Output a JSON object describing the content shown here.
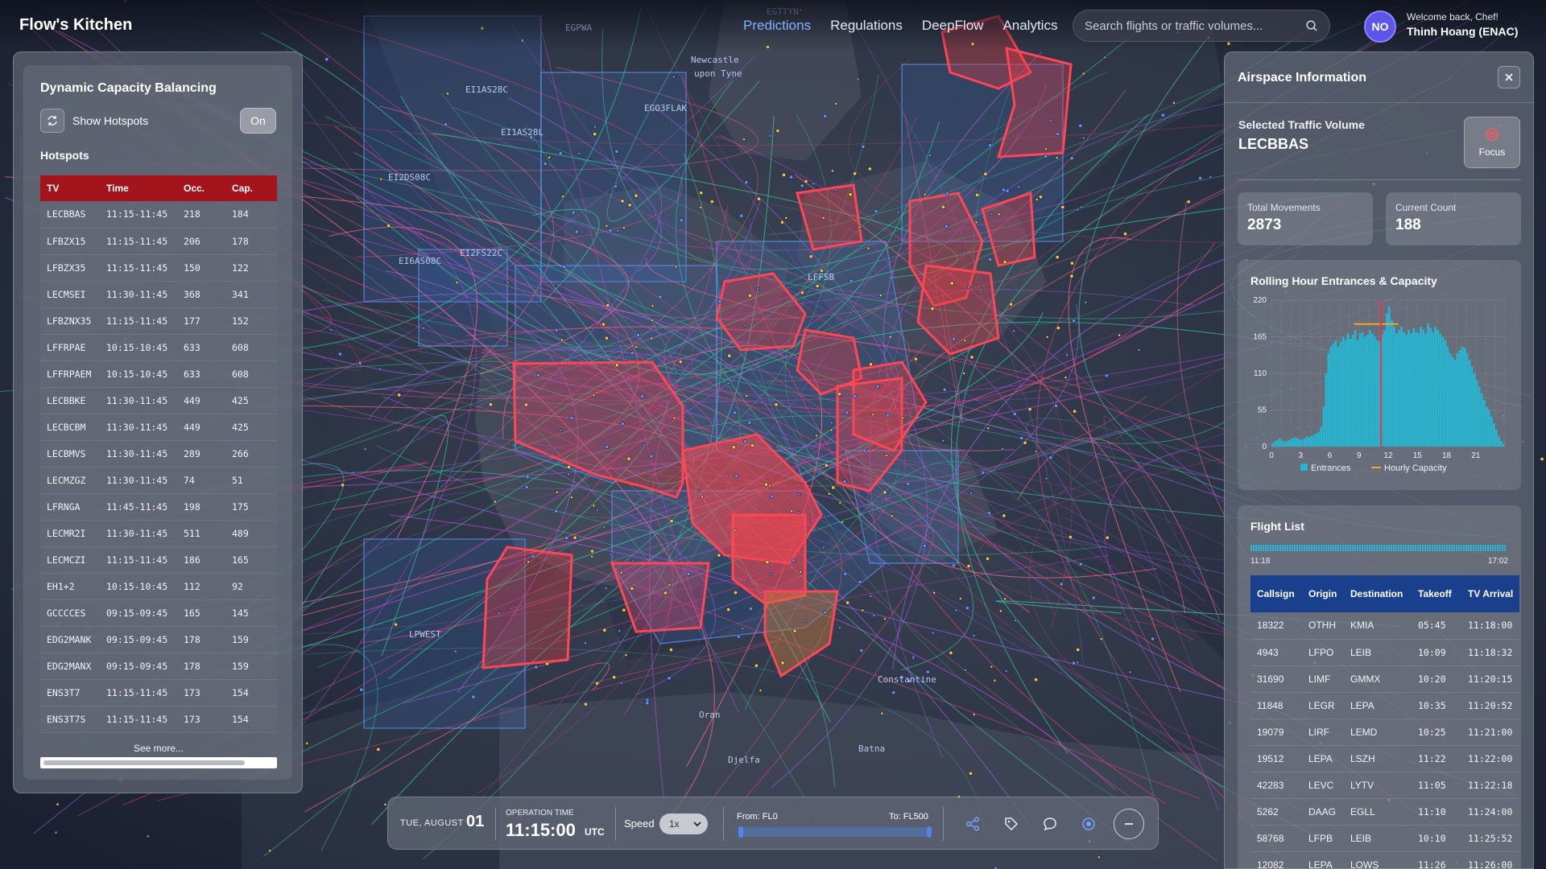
{
  "app": {
    "title": "Flow's Kitchen",
    "nav": [
      {
        "label": "Predictions",
        "active": true
      },
      {
        "label": "Regulations",
        "active": false
      },
      {
        "label": "DeepFlow",
        "active": false
      },
      {
        "label": "Analytics",
        "active": false
      }
    ],
    "search_placeholder": "Search flights or traffic volumes...",
    "user": {
      "initials": "NO",
      "welcome": "Welcome back, Chef!",
      "name": "Thinh Hoang (ENAC)"
    }
  },
  "map": {
    "labels": [
      "EGPWA",
      "EGTTYN",
      "EI1AS28C",
      "EI1AS28L",
      "EGO3FLAK",
      "EI2DS08C",
      "EI6AS08C",
      "EI2FS22C",
      "LFFSB",
      "LPWEST",
      "Newcastle",
      "upon Tyne",
      "Oran",
      "Batna",
      "Constantine",
      "Djelfa"
    ]
  },
  "left_panel": {
    "title": "Dynamic Capacity Balancing",
    "show_hotspots_label": "Show Hotspots",
    "toggle_label": "On",
    "hotspots_label": "Hotspots",
    "columns": [
      "TV",
      "Time",
      "Occ.",
      "Cap."
    ],
    "rows": [
      [
        "LECBBAS",
        "11:15-11:45",
        "218",
        "184"
      ],
      [
        "LFBZX15",
        "11:15-11:45",
        "206",
        "178"
      ],
      [
        "LFBZX35",
        "11:15-11:45",
        "150",
        "122"
      ],
      [
        "LECMSEI",
        "11:30-11:45",
        "368",
        "341"
      ],
      [
        "LFBZNX35",
        "11:15-11:45",
        "177",
        "152"
      ],
      [
        "LFFRPAE",
        "10:15-10:45",
        "633",
        "608"
      ],
      [
        "LFFRPAEM",
        "10:15-10:45",
        "633",
        "608"
      ],
      [
        "LECBBKE",
        "11:30-11:45",
        "449",
        "425"
      ],
      [
        "LECBCBM",
        "11:30-11:45",
        "449",
        "425"
      ],
      [
        "LECBMVS",
        "11:30-11:45",
        "289",
        "266"
      ],
      [
        "LECMZGZ",
        "11:30-11:45",
        "74",
        "51"
      ],
      [
        "LFRNGA",
        "11:45-11:45",
        "198",
        "175"
      ],
      [
        "LECMR2I",
        "11:30-11:45",
        "511",
        "489"
      ],
      [
        "LECMCZI",
        "11:15-11:45",
        "186",
        "165"
      ],
      [
        "EH1+2",
        "10:15-10:45",
        "112",
        "92"
      ],
      [
        "GCCCCES",
        "09:15-09:45",
        "165",
        "145"
      ],
      [
        "EDG2MANK",
        "09:15-09:45",
        "178",
        "159"
      ],
      [
        "EDG2MANX",
        "09:15-09:45",
        "178",
        "159"
      ],
      [
        "ENS3T7",
        "11:15-11:45",
        "173",
        "154"
      ],
      [
        "ENS3T7S",
        "11:15-11:45",
        "173",
        "154"
      ]
    ],
    "see_more": "See more..."
  },
  "right_panel": {
    "title": "Airspace Information",
    "selected_label": "Selected Traffic Volume",
    "selected_value": "LECBBAS",
    "focus_label": "Focus",
    "total_movements_label": "Total Movements",
    "total_movements": "2873",
    "current_count_label": "Current Count",
    "current_count": "188",
    "flight_list": {
      "title": "Flight List",
      "start_time": "11:18",
      "end_time": "17:02",
      "columns": [
        "Callsign",
        "Origin",
        "Destination",
        "Takeoff",
        "TV Arrival"
      ],
      "rows": [
        [
          "18322",
          "OTHH",
          "KMIA",
          "05:45",
          "11:18:00"
        ],
        [
          "4943",
          "LFPO",
          "LEIB",
          "10:09",
          "11:18:32"
        ],
        [
          "31690",
          "LIMF",
          "GMMX",
          "10:20",
          "11:20:15"
        ],
        [
          "11848",
          "LEGR",
          "LEPA",
          "10:35",
          "11:20:52"
        ],
        [
          "19079",
          "LIRF",
          "LEMD",
          "10:25",
          "11:21:00"
        ],
        [
          "19512",
          "LEPA",
          "LSZH",
          "11:22",
          "11:22:00"
        ],
        [
          "42283",
          "LEVC",
          "LYTV",
          "11:05",
          "11:22:18"
        ],
        [
          "5262",
          "DAAG",
          "EGLL",
          "11:10",
          "11:24:00"
        ],
        [
          "58768",
          "LFPB",
          "LEIB",
          "10:10",
          "11:25:52"
        ],
        [
          "12082",
          "LEPA",
          "LOWS",
          "11:26",
          "11:26:00"
        ]
      ]
    }
  },
  "chart_data": {
    "type": "bar",
    "title": "Rolling Hour Entrances & Capacity",
    "x_ticks": [
      0,
      3,
      6,
      9,
      12,
      15,
      18,
      21
    ],
    "y_ticks": [
      0,
      55,
      110,
      165,
      220
    ],
    "ylim": [
      0,
      220
    ],
    "xlim": [
      0,
      24
    ],
    "grid": true,
    "legend_position": "bottom",
    "series": [
      {
        "name": "Entrances",
        "color": "#2ab3cf",
        "x": [
          0,
          0.25,
          0.5,
          0.75,
          1,
          1.25,
          1.5,
          1.75,
          2,
          2.25,
          2.5,
          2.75,
          3,
          3.25,
          3.5,
          3.75,
          4,
          4.25,
          4.5,
          4.75,
          5,
          5.25,
          5.5,
          5.75,
          6,
          6.25,
          6.5,
          6.75,
          7,
          7.25,
          7.5,
          7.75,
          8,
          8.25,
          8.5,
          8.75,
          9,
          9.25,
          9.5,
          9.75,
          10,
          10.25,
          10.5,
          10.75,
          11,
          11.25,
          11.5,
          11.75,
          12,
          12.25,
          12.5,
          12.75,
          13,
          13.25,
          13.5,
          13.75,
          14,
          14.25,
          14.5,
          14.75,
          15,
          15.25,
          15.5,
          15.75,
          16,
          16.25,
          16.5,
          16.75,
          17,
          17.25,
          17.5,
          17.75,
          18,
          18.25,
          18.5,
          18.75,
          19,
          19.25,
          19.5,
          19.75,
          20,
          20.25,
          20.5,
          20.75,
          21,
          21.25,
          21.5,
          21.75,
          22,
          22.25,
          22.5,
          22.75,
          23,
          23.25,
          23.5,
          23.75
        ],
        "values": [
          5,
          8,
          10,
          12,
          9,
          7,
          8,
          10,
          12,
          14,
          13,
          11,
          10,
          12,
          15,
          14,
          16,
          18,
          20,
          22,
          30,
          60,
          110,
          140,
          150,
          155,
          160,
          150,
          158,
          165,
          160,
          170,
          162,
          168,
          175,
          160,
          170,
          172,
          165,
          168,
          175,
          170,
          165,
          160,
          158,
          168,
          175,
          200,
          210,
          190,
          180,
          170,
          175,
          180,
          172,
          168,
          175,
          170,
          178,
          172,
          170,
          180,
          175,
          170,
          185,
          178,
          172,
          180,
          175,
          170,
          165,
          160,
          150,
          140,
          135,
          130,
          140,
          145,
          150,
          148,
          140,
          130,
          120,
          110,
          100,
          90,
          80,
          70,
          60,
          55,
          45,
          35,
          25,
          15,
          8,
          4
        ]
      },
      {
        "name": "Hourly Capacity",
        "color": "#f5a623",
        "x": [
          8.5,
          13
        ],
        "values": [
          184,
          184
        ]
      }
    ],
    "marker_time": 11.25
  },
  "controls": {
    "date_label": "TUE, AUGUST",
    "day": "01",
    "op_time_label": "OPERATION TIME",
    "time": "11:15:00",
    "tz": "UTC",
    "speed_label": "Speed",
    "speed_value": "1x",
    "from_label": "From: FL0",
    "to_label": "To: FL500"
  }
}
